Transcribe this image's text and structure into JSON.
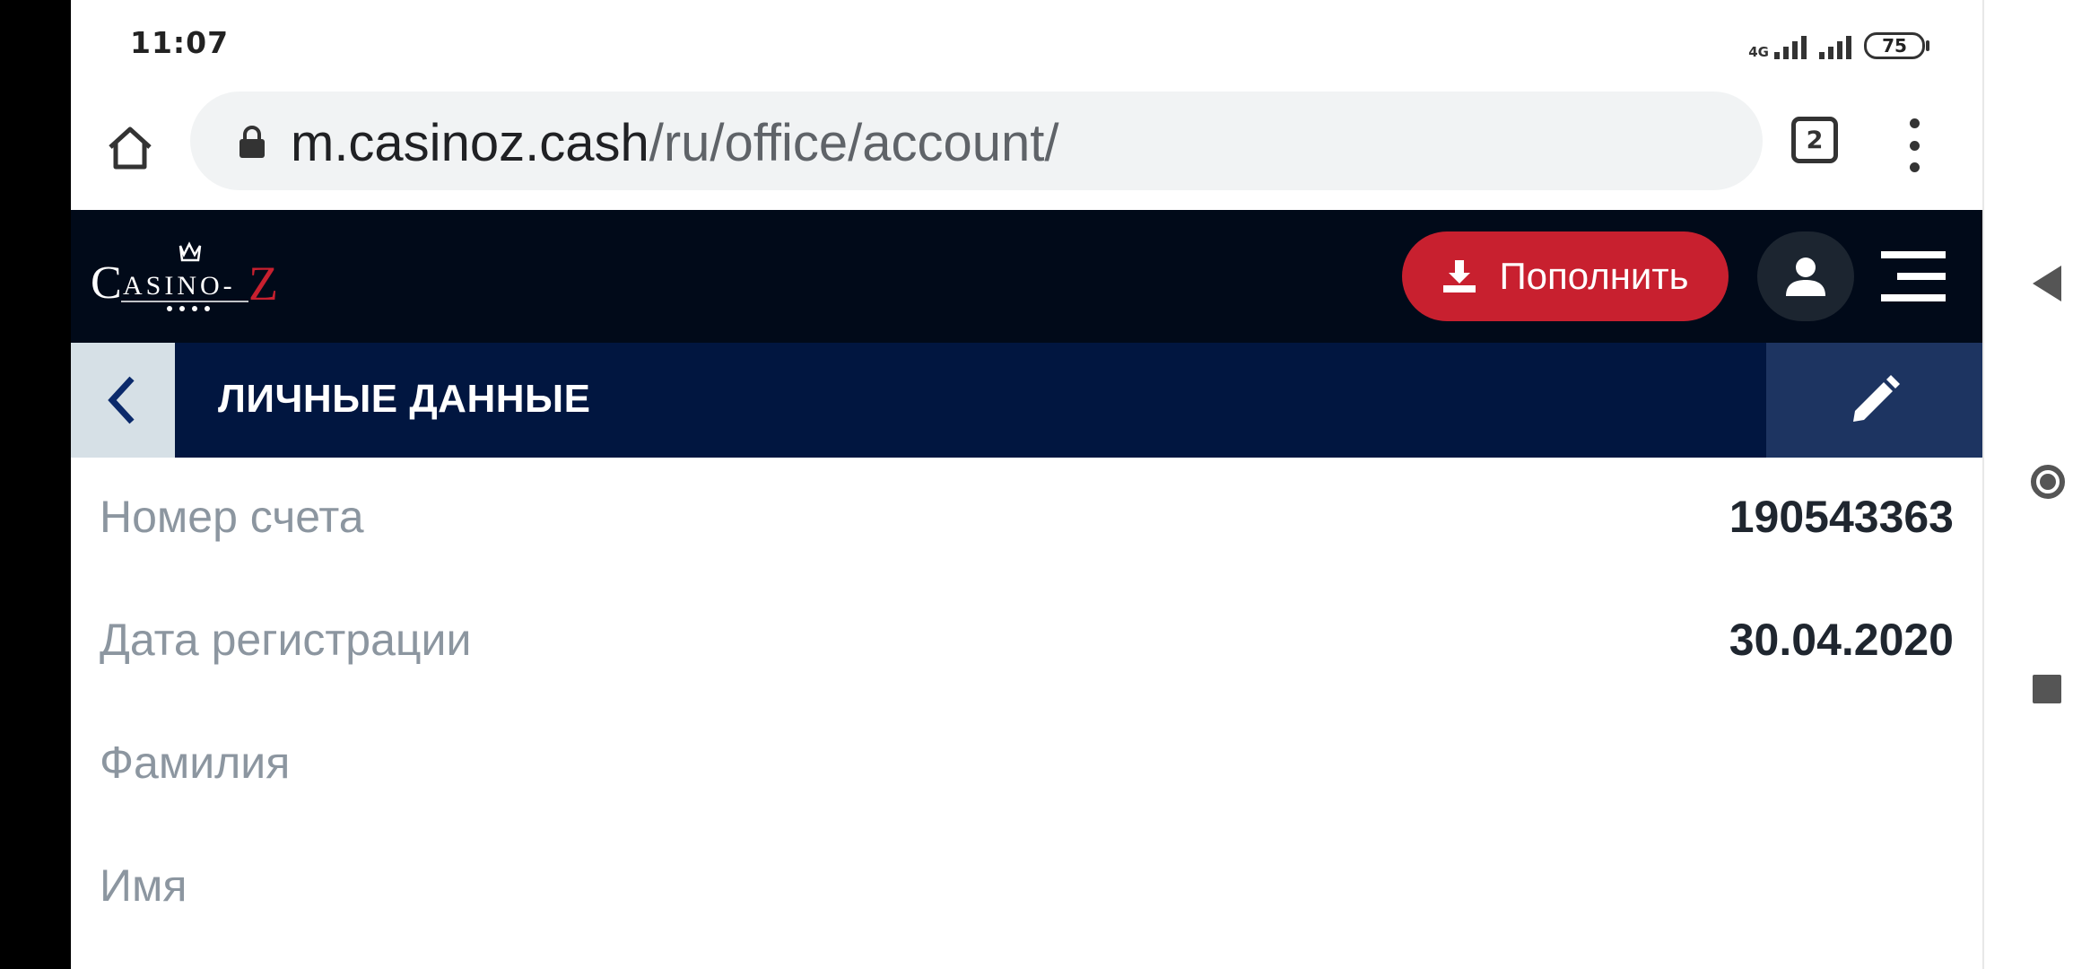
{
  "status": {
    "time": "11:07",
    "network_type": "4G",
    "battery": "75"
  },
  "browser": {
    "url_host": "m.casinoz.cash",
    "url_path": "/ru/office/account/",
    "tab_count": "2"
  },
  "site": {
    "logo_text": "CASINO-Z",
    "deposit_label": "Пополнить",
    "accent_color": "#c8202f",
    "header_bg": "#010a19"
  },
  "section": {
    "title": "ЛИЧНЫЕ ДАННЫЕ"
  },
  "fields": [
    {
      "label": "Номер счета",
      "value": "190543363"
    },
    {
      "label": "Дата регистрации",
      "value": "30.04.2020"
    },
    {
      "label": "Фамилия",
      "value": ""
    },
    {
      "label": "Имя",
      "value": ""
    }
  ]
}
